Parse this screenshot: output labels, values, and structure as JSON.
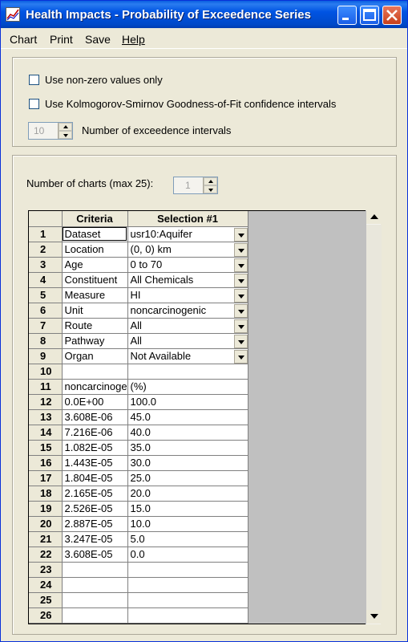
{
  "window": {
    "title": "Health Impacts - Probability of Exceedence Series",
    "accent": "#0054e3"
  },
  "menu": {
    "chart": "Chart",
    "print": "Print",
    "save": "Save",
    "help": "Help"
  },
  "options": {
    "nonzero_label": "Use non-zero values only",
    "nonzero_checked": false,
    "ks_label": "Use Kolmogorov-Smirnov Goodness-of-Fit confidence intervals",
    "ks_checked": false,
    "intervals_value": "10",
    "intervals_label": "Number of exceedence intervals"
  },
  "charts": {
    "count_label": "Number of charts (max 25):",
    "count_value": "1"
  },
  "grid": {
    "headers": [
      "Criteria",
      "Selection #1"
    ],
    "rows": [
      {
        "n": "1",
        "criteria": "Dataset",
        "selection": "usr10:Aquifer"
      },
      {
        "n": "2",
        "criteria": "Location",
        "selection": "(0, 0) km"
      },
      {
        "n": "3",
        "criteria": "Age",
        "selection": "0 to 70"
      },
      {
        "n": "4",
        "criteria": "Constituent",
        "selection": "All Chemicals"
      },
      {
        "n": "5",
        "criteria": "Measure",
        "selection": "HI"
      },
      {
        "n": "6",
        "criteria": "Unit",
        "selection": "noncarcinogenic"
      },
      {
        "n": "7",
        "criteria": "Route",
        "selection": "All"
      },
      {
        "n": "8",
        "criteria": "Pathway",
        "selection": "All"
      },
      {
        "n": "9",
        "criteria": "Organ",
        "selection": "Not Available"
      },
      {
        "n": "10",
        "criteria": "",
        "selection": ""
      },
      {
        "n": "11",
        "criteria": "noncarcinogenic",
        "selection": "(%)"
      },
      {
        "n": "12",
        "criteria": "0.0E+00",
        "selection": "100.0"
      },
      {
        "n": "13",
        "criteria": "3.608E-06",
        "selection": "45.0"
      },
      {
        "n": "14",
        "criteria": "7.216E-06",
        "selection": "40.0"
      },
      {
        "n": "15",
        "criteria": "1.082E-05",
        "selection": "35.0"
      },
      {
        "n": "16",
        "criteria": "1.443E-05",
        "selection": "30.0"
      },
      {
        "n": "17",
        "criteria": "1.804E-05",
        "selection": "25.0"
      },
      {
        "n": "18",
        "criteria": "2.165E-05",
        "selection": "20.0"
      },
      {
        "n": "19",
        "criteria": "2.526E-05",
        "selection": "15.0"
      },
      {
        "n": "20",
        "criteria": "2.887E-05",
        "selection": "10.0"
      },
      {
        "n": "21",
        "criteria": "3.247E-05",
        "selection": "5.0"
      },
      {
        "n": "22",
        "criteria": "3.608E-05",
        "selection": "0.0"
      },
      {
        "n": "23",
        "criteria": "",
        "selection": ""
      },
      {
        "n": "24",
        "criteria": "",
        "selection": ""
      },
      {
        "n": "25",
        "criteria": "",
        "selection": ""
      },
      {
        "n": "26",
        "criteria": "",
        "selection": ""
      }
    ]
  }
}
